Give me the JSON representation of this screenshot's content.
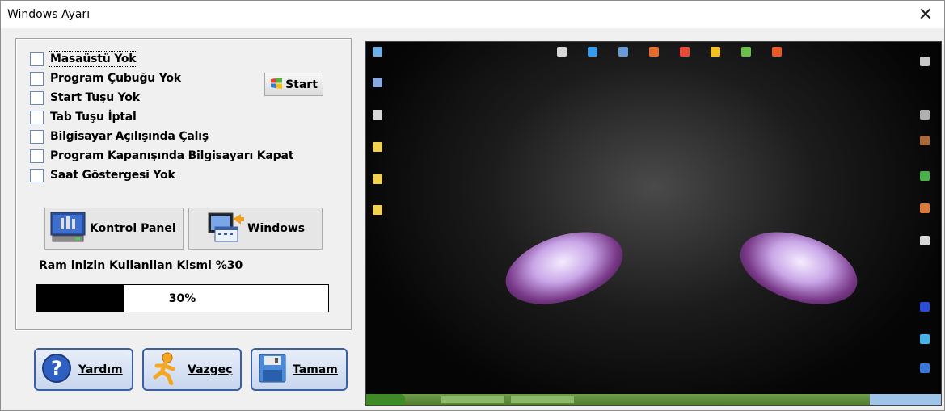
{
  "window": {
    "title": "Windows Ayarı",
    "close_glyph": "✕"
  },
  "options": [
    {
      "label": "Masaüstü Yok",
      "checked": false
    },
    {
      "label": "Program Çubuğu Yok",
      "checked": false
    },
    {
      "label": "Start Tuşu Yok",
      "checked": false
    },
    {
      "label": "Tab Tuşu İptal",
      "checked": false
    },
    {
      "label": "Bilgisayar Açılışında Çalış",
      "checked": false
    },
    {
      "label": "Program Kapanışında Bilgisayarı  Kapat",
      "checked": false
    },
    {
      "label": "Saat Göstergesi Yok",
      "checked": false
    }
  ],
  "start_button": {
    "label": "Start",
    "icon": "windows-flag-icon"
  },
  "buttons": {
    "kontrol_panel": {
      "label": "Kontrol Panel",
      "icon": "control-panel-icon"
    },
    "windows": {
      "label": "Windows",
      "icon": "windows-settings-icon"
    }
  },
  "ram": {
    "label": "Ram inizin Kullanilan Kismi %30",
    "percent_text": "30%",
    "percent": 30
  },
  "actions": {
    "help": {
      "label": "Yardım",
      "icon": "help-icon"
    },
    "cancel": {
      "label": "Vazgeç",
      "icon": "running-man-icon"
    },
    "ok": {
      "label": "Tamam",
      "icon": "floppy-disk-icon"
    }
  },
  "colors": {
    "accent_border": "#3a5fa5",
    "progress_fill": "#000000"
  }
}
